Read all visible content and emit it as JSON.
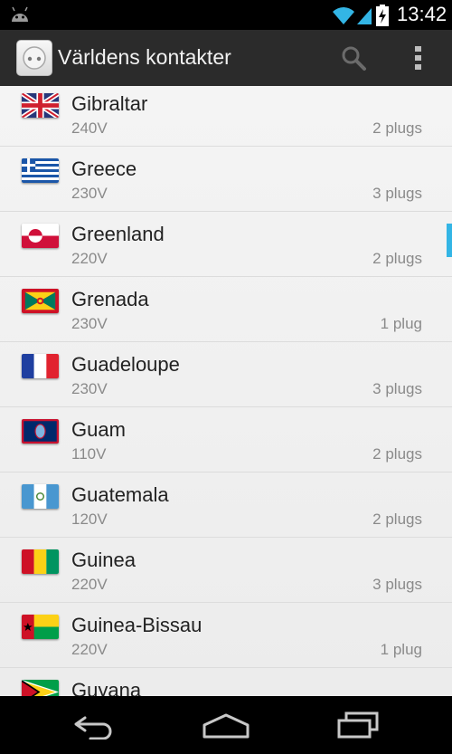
{
  "status_bar": {
    "time": "13:42",
    "icons": [
      "android-notification-icon",
      "wifi-icon",
      "signal-icon",
      "battery-charging-icon"
    ]
  },
  "action_bar": {
    "title": "Världens kontakter",
    "app_icon": "power-outlet-icon",
    "actions": [
      "search-icon",
      "overflow-menu-icon"
    ]
  },
  "list": {
    "items": [
      {
        "country": "Gibraltar",
        "voltage": "240V",
        "plugs": "2 plugs",
        "flag": "uk-flag-icon"
      },
      {
        "country": "Greece",
        "voltage": "230V",
        "plugs": "3 plugs",
        "flag": "greece-flag-icon"
      },
      {
        "country": "Greenland",
        "voltage": "220V",
        "plugs": "2 plugs",
        "flag": "greenland-flag-icon"
      },
      {
        "country": "Grenada",
        "voltage": "230V",
        "plugs": "1 plug",
        "flag": "grenada-flag-icon"
      },
      {
        "country": "Guadeloupe",
        "voltage": "230V",
        "plugs": "3 plugs",
        "flag": "france-flag-icon"
      },
      {
        "country": "Guam",
        "voltage": "110V",
        "plugs": "2 plugs",
        "flag": "guam-flag-icon"
      },
      {
        "country": "Guatemala",
        "voltage": "120V",
        "plugs": "2 plugs",
        "flag": "guatemala-flag-icon"
      },
      {
        "country": "Guinea",
        "voltage": "220V",
        "plugs": "3 plugs",
        "flag": "guinea-flag-icon"
      },
      {
        "country": "Guinea-Bissau",
        "voltage": "220V",
        "plugs": "1 plug",
        "flag": "guinea-bissau-flag-icon"
      },
      {
        "country": "Guyana",
        "voltage": "",
        "plugs": "",
        "flag": "guyana-flag-icon"
      }
    ]
  },
  "nav_bar": {
    "buttons": [
      "back-icon",
      "home-icon",
      "recents-icon"
    ]
  },
  "colors": {
    "accent": "#33b5e5",
    "action_bar": "#2b2b2b",
    "list_background": "#f2f2f2",
    "primary_text": "#222222",
    "secondary_text": "#8a8a8a"
  }
}
